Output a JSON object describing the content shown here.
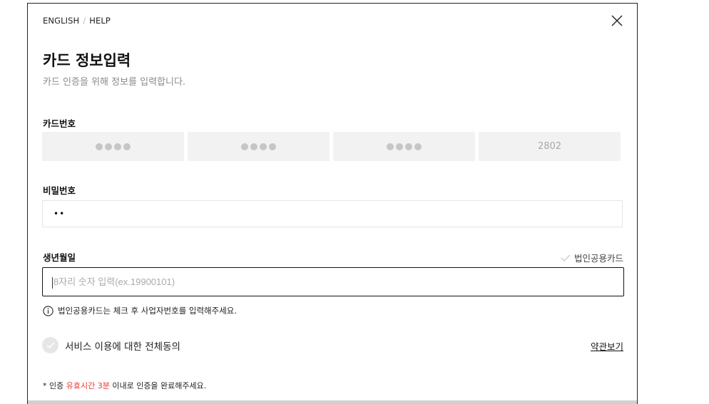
{
  "nav": {
    "english": "ENGLISH",
    "separator": "/",
    "help": "HELP"
  },
  "header": {
    "title": "카드 정보입력",
    "subtitle": "카드 인증을 위해 정보를 입력합니다."
  },
  "card_number": {
    "label": "카드번호",
    "segments": [
      "●●●●",
      "●●●●",
      "●●●●",
      "2802"
    ]
  },
  "password": {
    "label": "비밀번호",
    "value": "••"
  },
  "birth": {
    "label": "생년월일",
    "placeholder": "8자리 숫자 입력(ex.19900101)",
    "corporate_card_label": "법인공용카드"
  },
  "info_text": "법인공용카드는 체크 후 사업자번호를 입력해주세요.",
  "agreement": {
    "label": "서비스 이용에 대한 전체동의",
    "terms_link": "약관보기"
  },
  "notice": {
    "prefix": "* 인증 ",
    "highlight": "유효시간 3분",
    "suffix": " 이내로 인증을 완료해주세요."
  },
  "colors": {
    "highlight": "#e53935",
    "input_bg": "#f2f2f2",
    "border_active": "#111111"
  },
  "icons": [
    "close-icon",
    "check-icon",
    "info-icon",
    "checkbox-check-icon"
  ]
}
